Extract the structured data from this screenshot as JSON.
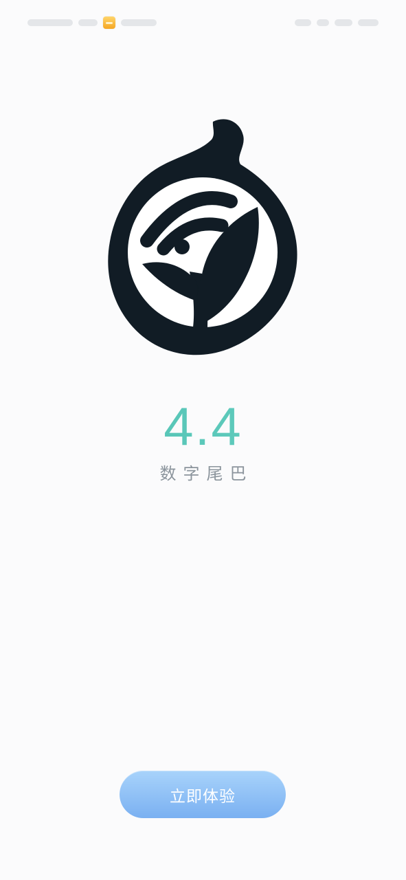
{
  "status_bar": {
    "icons": [
      "notification-wallet-icon",
      "wifi-icon",
      "battery-icon"
    ],
    "wallet_icon_color": "#f5a623"
  },
  "logo": {
    "icon": "leaf-signal-logo-icon",
    "color": "#111c25"
  },
  "version": "4.4",
  "app_name": "数字尾巴",
  "cta_button": {
    "label": "立即体验"
  },
  "colors": {
    "background": "#fbfbfc",
    "accent": "#58c8b8",
    "button": "#8bbcf5",
    "text_muted": "#8b949c"
  }
}
